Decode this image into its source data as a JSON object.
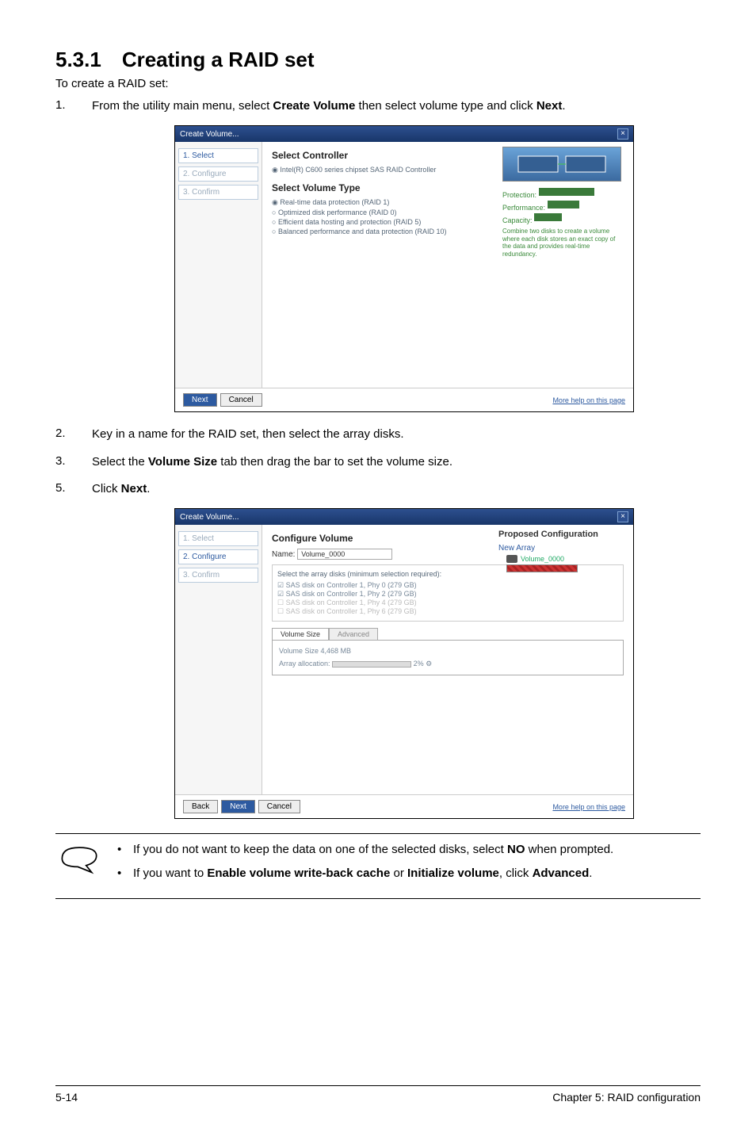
{
  "heading": "5.3.1 Creating a RAID set",
  "intro": "To create a RAID set:",
  "step1_num": "1.",
  "step1_a": "From the utility main menu, select ",
  "step1_b": "Create Volume",
  "step1_c": " then select volume type and click ",
  "step1_d": "Next",
  "step1_e": ".",
  "shot1": {
    "title": "Create Volume...",
    "sidebar": {
      "s1": "1. Select",
      "s2": "2. Configure",
      "s3": "3. Confirm"
    },
    "panel_title1": "Select Controller",
    "controller_radio": "Intel(R) C600 series chipset SAS RAID Controller",
    "panel_title2": "Select Volume Type",
    "vt1": "Real-time data protection (RAID 1)",
    "vt2": "Optimized disk performance (RAID 0)",
    "vt3": "Efficient data hosting and protection (RAID 5)",
    "vt4": "Balanced performance and data protection (RAID 10)",
    "right_lbl1": "Protection:",
    "right_lbl2": "Performance:",
    "right_lbl3": "Capacity:",
    "right_desc": "Combine two disks to create a volume where each disk stores an exact copy of the data and provides real-time redundancy.",
    "btn_next": "Next",
    "btn_cancel": "Cancel",
    "helplink": "More help on this page"
  },
  "step2_num": "2.",
  "step2_txt": "Key in a name for the RAID set, then select the array disks.",
  "step3_num": "3.",
  "step3_a": "Select the ",
  "step3_b": "Volume Size",
  "step3_c": " tab then drag the bar to set the volume size.",
  "step5_num": "5.",
  "step5_a": "Click ",
  "step5_b": "Next",
  "step5_c": ".",
  "shot2": {
    "title": "Create Volume...",
    "sidebar": {
      "s1": "1. Select",
      "s2": "2. Configure",
      "s3": "3. Confirm"
    },
    "panel_title": "Configure Volume",
    "name_label": "Name:",
    "name_value": "Volume_0000",
    "disk_intro": "Select the array disks (minimum selection required):",
    "d1": "SAS disk on Controller 1, Phy 0 (279 GB)",
    "d2": "SAS disk on Controller 1, Phy 2 (279 GB)",
    "d3": "SAS disk on Controller 1, Phy 4 (279 GB)",
    "d4": "SAS disk on Controller 1, Phy 6 (279 GB)",
    "tab1": "Volume Size",
    "tab2": "Advanced",
    "vol_size_line": "Volume Size 4,468 MB",
    "alloc_label": "Array allocation:",
    "alloc_pct": "2%",
    "proposed_title": "Proposed Configuration",
    "new_array": "New Array",
    "vol_item": "Volume_0000",
    "btn_back": "Back",
    "btn_next": "Next",
    "btn_cancel": "Cancel",
    "helplink": "More help on this page"
  },
  "note": {
    "b1a": "If you do not want to keep the data on one of the selected disks, select ",
    "b1b": "NO",
    "b1c": " when prompted.",
    "b2a": "If you want to ",
    "b2b": "Enable volume write-back cache",
    "b2c": " or ",
    "b2d": "Initialize volume",
    "b2e": ", click ",
    "b2f": "Advanced",
    "b2g": "."
  },
  "footer": {
    "left": "5-14",
    "right": "Chapter 5: RAID configuration"
  }
}
